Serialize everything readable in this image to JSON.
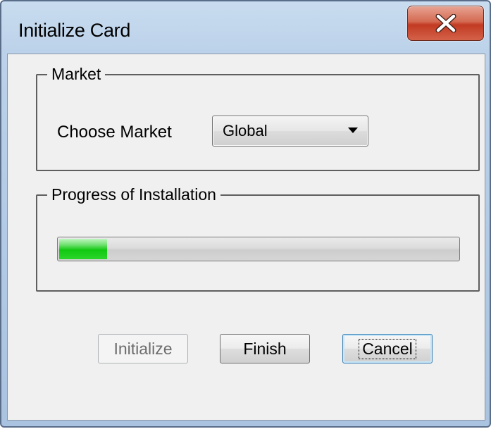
{
  "window": {
    "title": "Initialize Card",
    "close_icon": "close-x-icon"
  },
  "market_group": {
    "legend": "Market",
    "choose_label": "Choose Market",
    "select_value": "Global"
  },
  "progress_group": {
    "legend": "Progress of Installation",
    "progress_fraction": 0.12
  },
  "buttons": {
    "initialize": "Initialize",
    "finish": "Finish",
    "cancel": "Cancel"
  },
  "colors": {
    "progress_green": "#11c811",
    "close_red": "#c23a22"
  }
}
